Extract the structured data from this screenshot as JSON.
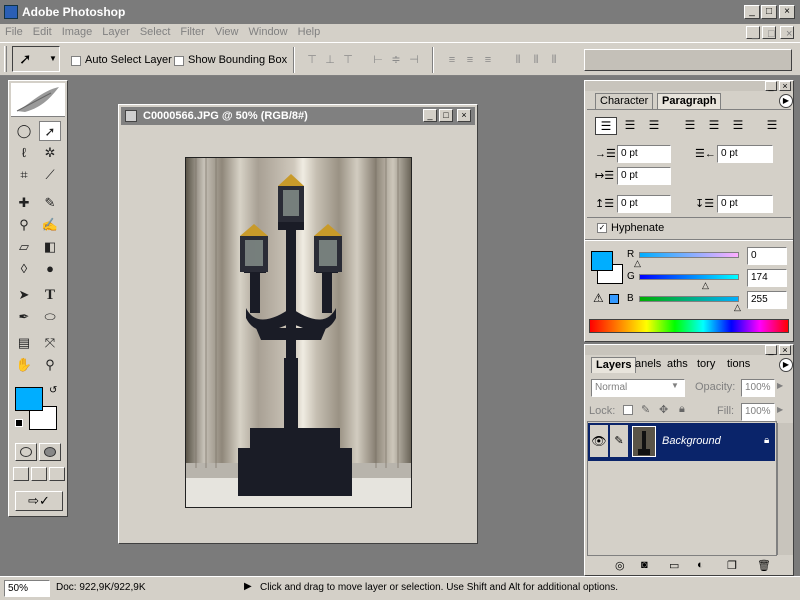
{
  "app": {
    "title": "Adobe Photoshop",
    "window_controls": [
      "_",
      "□",
      "×"
    ]
  },
  "menu": {
    "items": [
      "File",
      "Edit",
      "Image",
      "Layer",
      "Select",
      "Filter",
      "View",
      "Window",
      "Help"
    ],
    "controls": [
      "_",
      "□",
      "×"
    ]
  },
  "options": {
    "auto_select_label": "Auto Select Layer",
    "show_bounding_label": "Show Bounding Box"
  },
  "document": {
    "title": "C0000566.JPG @ 50% (RGB/8#)",
    "controls": [
      "_",
      "□",
      "×"
    ]
  },
  "char_panel": {
    "tabs": [
      "Character",
      "Paragraph"
    ],
    "indent_left": "0 pt",
    "indent_right": "0 pt",
    "indent_first": "0 pt",
    "space_before": "0 pt",
    "space_after": "0 pt",
    "hyphenate_label": "Hyphenate",
    "color": {
      "r_label": "R",
      "g_label": "G",
      "b_label": "B",
      "r": "0",
      "g": "174",
      "b": "255",
      "r_value": 0,
      "g_value": 174,
      "b_value": 255,
      "swatch": "#00aeff"
    }
  },
  "layers_panel": {
    "tabs": [
      "Layers",
      "anels",
      "aths",
      "tory",
      "tions"
    ],
    "blend_mode": "Normal",
    "opacity_label": "Opacity:",
    "opacity_value": "100%",
    "lock_label": "Lock:",
    "fill_label": "Fill:",
    "fill_value": "100%",
    "layer_name": "Background"
  },
  "status": {
    "zoom": "50%",
    "doc": "Doc: 922,9K/922,9K",
    "message": "Click and drag to move layer or selection.  Use Shift and Alt for additional options."
  },
  "colors": {
    "foreground": "#00aeff",
    "background": "#ffffff",
    "selection": "#0a246a"
  }
}
